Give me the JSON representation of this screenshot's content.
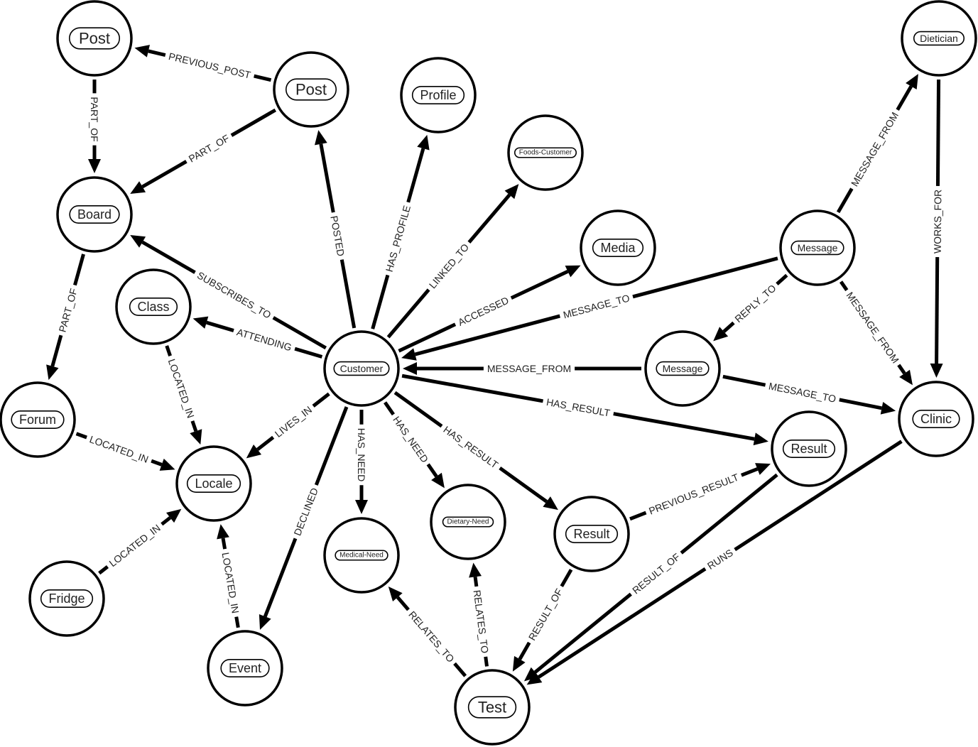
{
  "colors": {
    "stroke": "#000000",
    "background": "#ffffff",
    "text": "#222222"
  },
  "nodes": [
    {
      "id": "post1",
      "label": "Post",
      "size": "large"
    },
    {
      "id": "post2",
      "label": "Post",
      "size": "large"
    },
    {
      "id": "profile",
      "label": "Profile",
      "size": "medium"
    },
    {
      "id": "foods",
      "label": "Foods-Customer",
      "size": "tiny"
    },
    {
      "id": "dietician",
      "label": "Dietician",
      "size": "small"
    },
    {
      "id": "board",
      "label": "Board",
      "size": "medium"
    },
    {
      "id": "media",
      "label": "Media",
      "size": "medium"
    },
    {
      "id": "message1",
      "label": "Message",
      "size": "small"
    },
    {
      "id": "class",
      "label": "Class",
      "size": "medium"
    },
    {
      "id": "customer",
      "label": "Customer",
      "size": "small"
    },
    {
      "id": "message2",
      "label": "Message",
      "size": "small"
    },
    {
      "id": "forum",
      "label": "Forum",
      "size": "medium"
    },
    {
      "id": "clinic",
      "label": "Clinic",
      "size": "medium"
    },
    {
      "id": "locale",
      "label": "Locale",
      "size": "medium"
    },
    {
      "id": "result1",
      "label": "Result",
      "size": "medium"
    },
    {
      "id": "result2",
      "label": "Result",
      "size": "medium"
    },
    {
      "id": "dietary",
      "label": "Dietary-Need",
      "size": "tiny"
    },
    {
      "id": "medical",
      "label": "Medical-Need",
      "size": "tiny"
    },
    {
      "id": "fridge",
      "label": "Fridge",
      "size": "medium"
    },
    {
      "id": "event",
      "label": "Event",
      "size": "medium"
    },
    {
      "id": "test",
      "label": "Test",
      "size": "large"
    }
  ],
  "edges": [
    {
      "from": "post2",
      "to": "post1",
      "label": "PREVIOUS_POST"
    },
    {
      "from": "post1",
      "to": "board",
      "label": "PART_OF"
    },
    {
      "from": "post2",
      "to": "board",
      "label": "PART_OF"
    },
    {
      "from": "board",
      "to": "forum",
      "label": "PART_OF"
    },
    {
      "from": "customer",
      "to": "board",
      "label": "SUBSCRIBES_TO"
    },
    {
      "from": "customer",
      "to": "class",
      "label": "ATTENDING"
    },
    {
      "from": "customer",
      "to": "post2",
      "label": "POSTED"
    },
    {
      "from": "customer",
      "to": "profile",
      "label": "HAS_PROFILE"
    },
    {
      "from": "customer",
      "to": "foods",
      "label": "LINKED_TO"
    },
    {
      "from": "customer",
      "to": "media",
      "label": "ACCESSED"
    },
    {
      "from": "message1",
      "to": "customer",
      "label": "MESSAGE_TO"
    },
    {
      "from": "message2",
      "to": "customer",
      "label": "MESSAGE_FROM"
    },
    {
      "from": "message1",
      "to": "dietician",
      "label": "MESSAGE_FROM"
    },
    {
      "from": "dietician",
      "to": "clinic",
      "label": "WORKS_FOR"
    },
    {
      "from": "message1",
      "to": "message2",
      "label": "REPLY_TO"
    },
    {
      "from": "message1",
      "to": "clinic",
      "label": "MESSAGE_FROM"
    },
    {
      "from": "message2",
      "to": "clinic",
      "label": "MESSAGE_TO"
    },
    {
      "from": "customer",
      "to": "result1",
      "label": "HAS_RESULT"
    },
    {
      "from": "customer",
      "to": "result2",
      "label": "HAS_RESULT"
    },
    {
      "from": "customer",
      "to": "dietary",
      "label": "HAS_NEED"
    },
    {
      "from": "customer",
      "to": "medical",
      "label": "HAS_NEED"
    },
    {
      "from": "customer",
      "to": "locale",
      "label": "LIVES_IN"
    },
    {
      "from": "customer",
      "to": "event",
      "label": "DECLINED"
    },
    {
      "from": "class",
      "to": "locale",
      "label": "LOCATED_IN"
    },
    {
      "from": "forum",
      "to": "locale",
      "label": "LOCATED_IN"
    },
    {
      "from": "fridge",
      "to": "locale",
      "label": "LOCATED_IN"
    },
    {
      "from": "event",
      "to": "locale",
      "label": "LOCATED_IN"
    },
    {
      "from": "result2",
      "to": "result1",
      "label": "PREVIOUS_RESULT"
    },
    {
      "from": "result2",
      "to": "test",
      "label": "RESULT_OF"
    },
    {
      "from": "result1",
      "to": "test",
      "label": "RESULT_OF"
    },
    {
      "from": "clinic",
      "to": "test",
      "label": "RUNS"
    },
    {
      "from": "test",
      "to": "medical",
      "label": "RELATES_TO"
    },
    {
      "from": "test",
      "to": "dietary",
      "label": "RELATES_TO"
    }
  ]
}
